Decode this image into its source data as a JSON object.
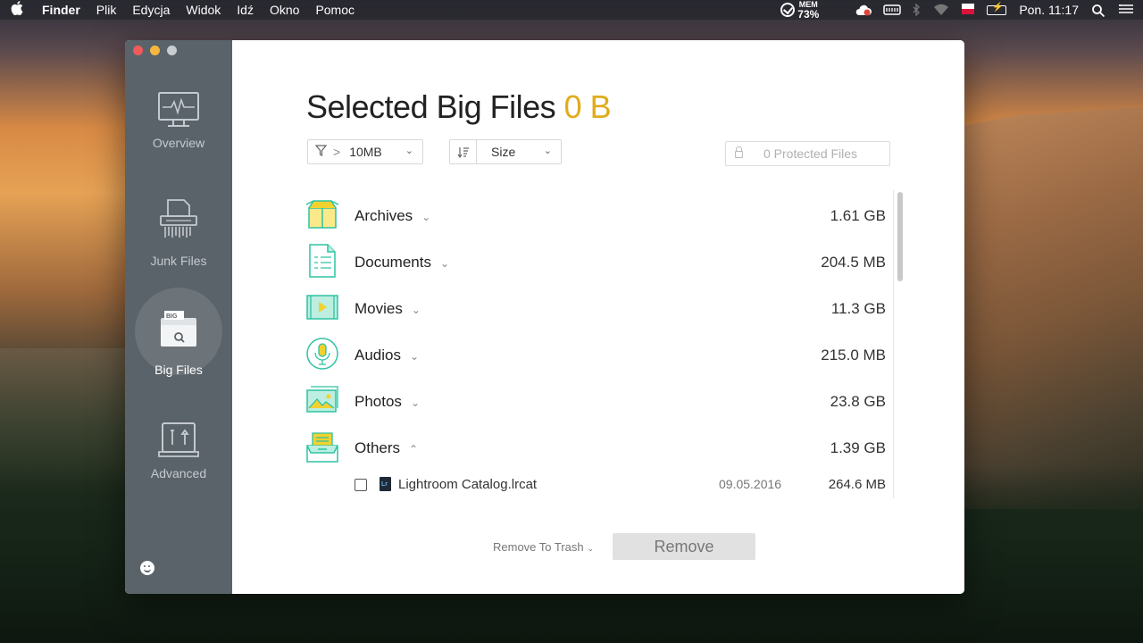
{
  "menubar": {
    "apple": "",
    "items": [
      {
        "label": "Finder",
        "bold": true
      },
      {
        "label": "Plik"
      },
      {
        "label": "Edycja"
      },
      {
        "label": "Widok"
      },
      {
        "label": "Idź"
      },
      {
        "label": "Okno"
      },
      {
        "label": "Pomoc"
      }
    ],
    "mem_label": "MEM",
    "mem_percent": "73%",
    "clock": "Pon. 11:17",
    "icons": [
      "memory-clean-icon",
      "cloud-sync-icon",
      "keyboard-icon",
      "bluetooth-icon",
      "wifi-icon",
      "flag-pl-icon",
      "battery-icon",
      "search-icon",
      "list-icon"
    ]
  },
  "sidebar": {
    "items": [
      {
        "label": "Overview",
        "icon": "monitor-icon",
        "active": false
      },
      {
        "label": "Junk Files",
        "icon": "shredder-icon",
        "active": false
      },
      {
        "label": "Big Files",
        "icon": "big-files-icon",
        "active": true
      },
      {
        "label": "Advanced",
        "icon": "toolbox-icon",
        "active": false
      }
    ],
    "bottom_icon": "smiley-icon"
  },
  "header": {
    "title": "Selected Big Files",
    "amount": "0 B"
  },
  "filter": {
    "value": "10MB",
    "symbol": ">"
  },
  "sort": {
    "value": "Size"
  },
  "protected": {
    "label": "0 Protected Files"
  },
  "categories": [
    {
      "name": "Archives",
      "size": "1.61 GB",
      "expanded": false,
      "icon": "archive-box-icon"
    },
    {
      "name": "Documents",
      "size": "204.5 MB",
      "expanded": false,
      "icon": "document-icon"
    },
    {
      "name": "Movies",
      "size": "11.3 GB",
      "expanded": false,
      "icon": "movie-icon"
    },
    {
      "name": "Audios",
      "size": "215.0 MB",
      "expanded": false,
      "icon": "microphone-icon"
    },
    {
      "name": "Photos",
      "size": "23.8 GB",
      "expanded": false,
      "icon": "photo-icon"
    },
    {
      "name": "Others",
      "size": "1.39 GB",
      "expanded": true,
      "icon": "tray-icon"
    }
  ],
  "files": [
    {
      "name": "Lightroom Catalog.lrcat",
      "date": "09.05.2016",
      "size": "264.6 MB",
      "checked": false
    }
  ],
  "footer": {
    "trash_option": "Remove To Trash",
    "remove_label": "Remove"
  },
  "colors": {
    "accent": "#e0ac1c",
    "teal": "#2dc3a2",
    "yellow": "#f3d22e",
    "sidebar": "#5a636a"
  }
}
